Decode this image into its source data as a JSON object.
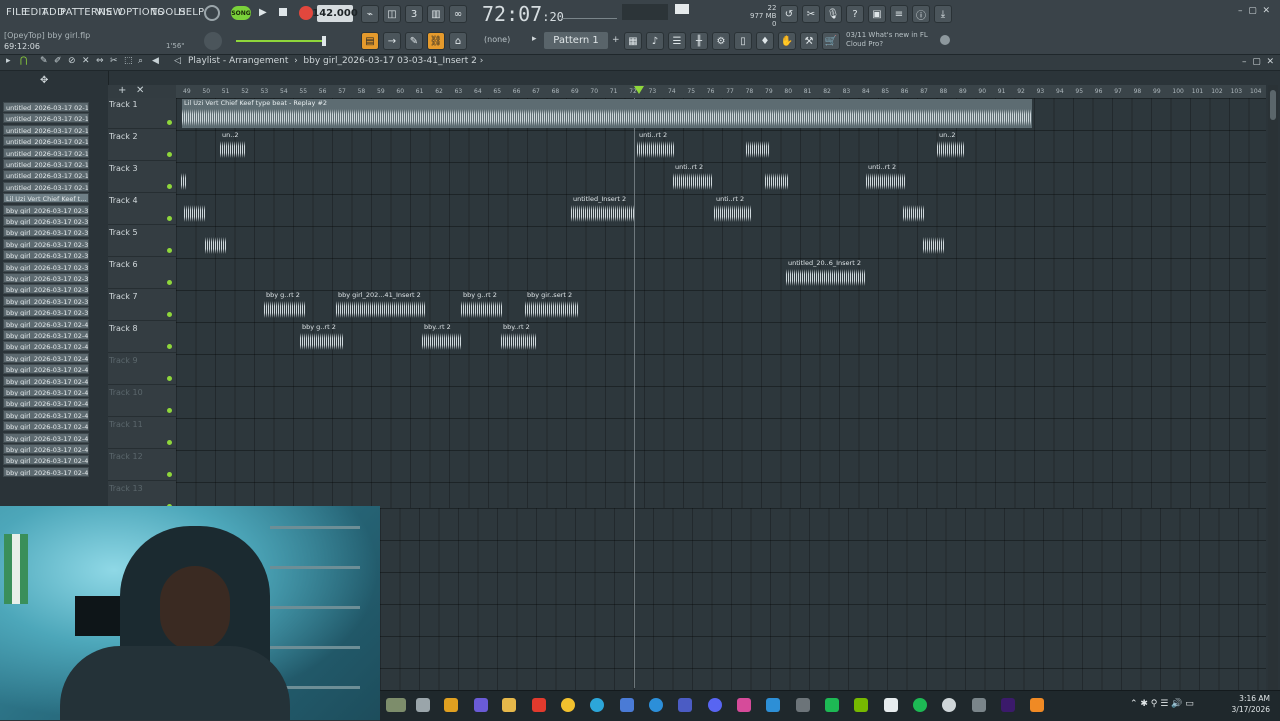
{
  "menu": [
    "FILE",
    "EDIT",
    "ADD",
    "PATTERNS",
    "VIEW",
    "OPTIONS",
    "TOOLS",
    "HELP"
  ],
  "transport": {
    "song_label": "SONG",
    "tempo": "142.000",
    "time": "72:07",
    "time_small": ":20"
  },
  "file": {
    "recent": "[OpeyTop] bby girl.flp",
    "position": "69:12:06",
    "hint": "1'56\""
  },
  "cpu": {
    "cpu": "22",
    "ram": "977 MB",
    "zero": "0"
  },
  "pattern": {
    "selector": "(none)",
    "name": "Pattern 1"
  },
  "news": {
    "line1": "03/11  What's new in FL",
    "line2": "Cloud Pro?"
  },
  "playlist": {
    "title": "Playlist - Arrangement",
    "breadcrumb": "bby girl_2026-03-17 03-03-41_Insert 2"
  },
  "browser_items": [
    "untitled_2026-03-17 02-16...",
    "untitled_2026-03-17 02-16...",
    "untitled_2026-03-17 02-16...",
    "untitled_2026-03-17 02-16...",
    "untitled_2026-03-17 02-16...",
    "untitled_2026-03-17 02-16...",
    "untitled_2026-03-17 02-16...",
    "untitled_2026-03-17 02-16...",
    "Lil Uzi Vert Chief Keef t...",
    "bby girl_2026-03-17 02-33...",
    "bby girl_2026-03-17 02-33...",
    "bby girl_2026-03-17 02-34...",
    "bby girl_2026-03-17 02-35...",
    "bby girl_2026-03-17 02-35...",
    "bby girl_2026-03-17 02-36...",
    "bby girl_2026-03-17 02-36...",
    "bby girl_2026-03-17 02-39...",
    "bby girl_2026-03-17 02-39...",
    "bby girl_2026-03-17 02-39...",
    "bby girl_2026-03-17 02-40...",
    "bby girl_2026-03-17 02-40...",
    "bby girl_2026-03-17 02-41...",
    "bby girl_2026-03-17 02-42...",
    "bby girl_2026-03-17 02-43...",
    "bby girl_2026-03-17 02-43...",
    "bby girl_2026-03-17 02-43...",
    "bby girl_2026-03-17 02-45...",
    "bby girl_2026-03-17 02-45...",
    "bby girl_2026-03-17 02-45...",
    "bby girl_2026-03-17 02-46...",
    "bby girl_2026-03-17 02-46...",
    "bby girl_2026-03-17 02-47...",
    "bby girl_2026-03-17 02-47..."
  ],
  "tracks": [
    "Track 1",
    "Track 2",
    "Track 3",
    "Track 4",
    "Track 5",
    "Track 6",
    "Track 7",
    "Track 8",
    "Track 9",
    "Track 10",
    "Track 11",
    "Track 12",
    "Track 13"
  ],
  "timeline_ticks": [
    "49",
    "50",
    "51",
    "52",
    "53",
    "54",
    "55",
    "56",
    "57",
    "58",
    "59",
    "60",
    "61",
    "62",
    "63",
    "64",
    "65",
    "66",
    "67",
    "68",
    "69",
    "70",
    "71",
    "72",
    "73",
    "74",
    "75",
    "76",
    "77",
    "78",
    "79",
    "80",
    "81",
    "82",
    "83",
    "84",
    "85",
    "86",
    "87",
    "88",
    "89",
    "90",
    "91",
    "92",
    "93",
    "94",
    "95",
    "96",
    "97",
    "98",
    "99",
    "100",
    "101",
    "102",
    "103",
    "104"
  ],
  "clips": {
    "t1": "Lil Uzi Vert  Chief Keef type beat - Replay #2",
    "t2a": "un..2",
    "t2b": "unti..rt 2",
    "t2c": "",
    "t2d": "un..2",
    "t3a": "unti..rt 2",
    "t3b": "",
    "t3c": "unti..rt 2",
    "t4a": "",
    "t4b": "untitled_Insert 2",
    "t4c": "unti..rt 2",
    "t4d": "",
    "t5a": "",
    "t5b": "",
    "t6": "untitled_20..6_Insert 2",
    "t7a": "bby g..rt 2",
    "t7b": "bby girl_202...41_Insert 2",
    "t7c": "bby g..rt 2",
    "t7d": "bby gir..sert 2",
    "t8a": "bby g..rt 2",
    "t8b": "bby..rt 2",
    "t8c": "bby..rt 2"
  },
  "clock": {
    "time": "3:16 AM",
    "date": "3/17/2026"
  }
}
